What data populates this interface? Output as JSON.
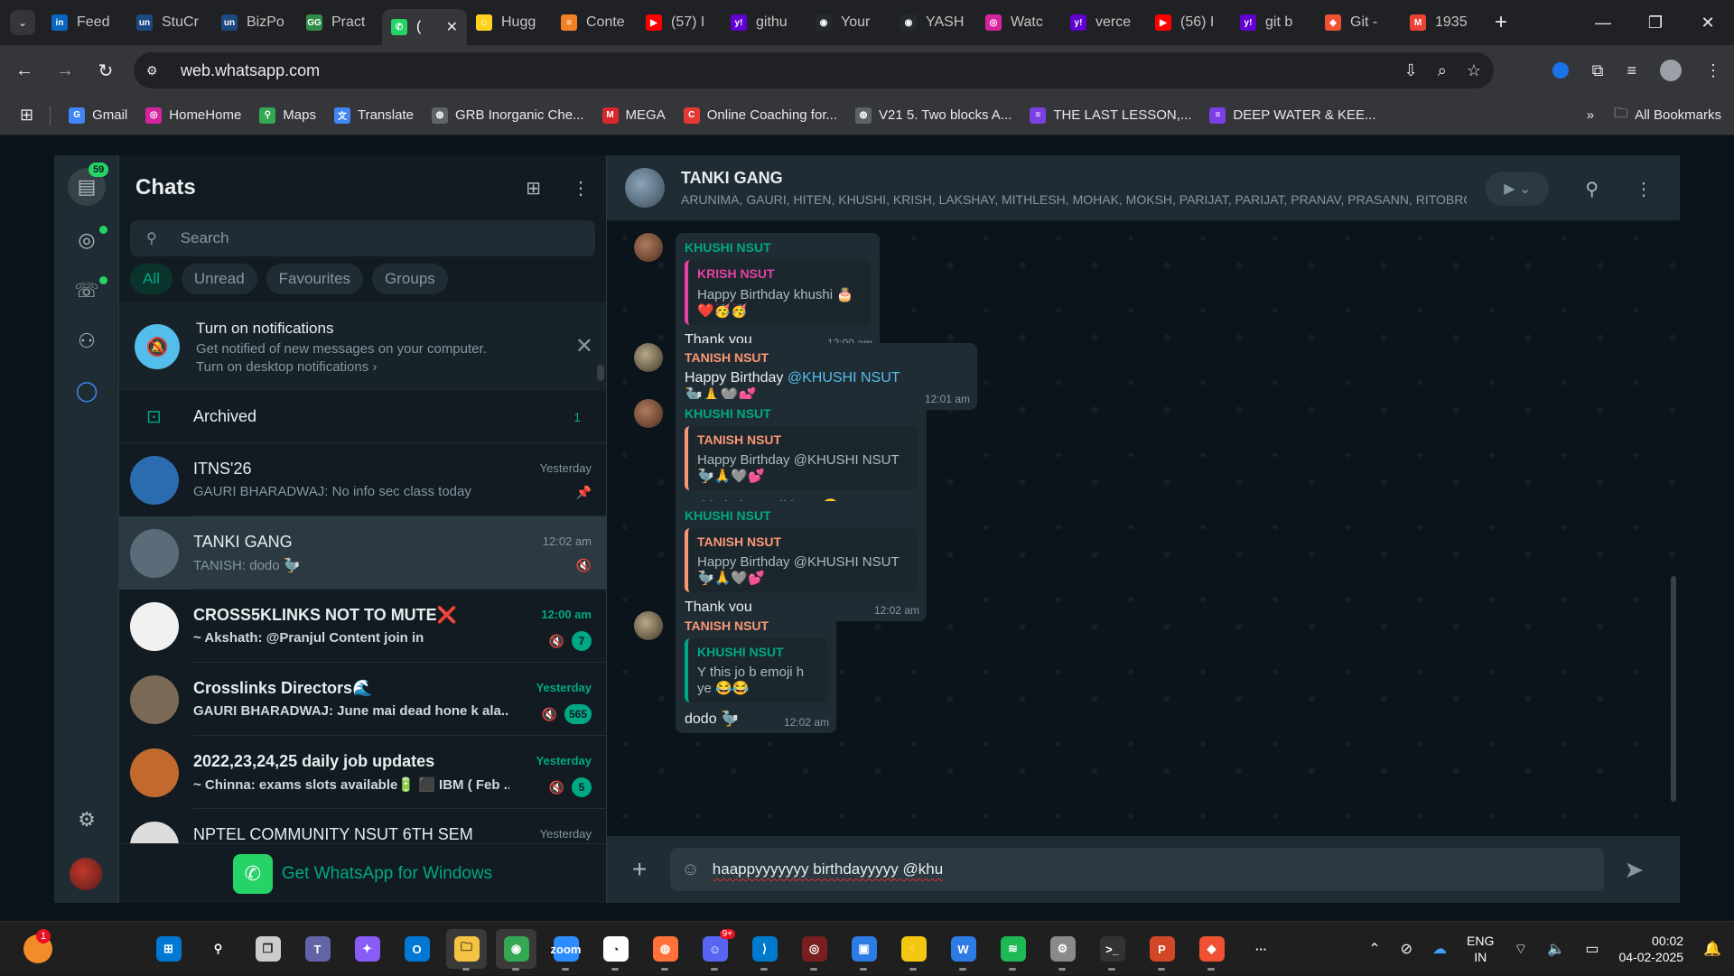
{
  "browser": {
    "tabs": [
      {
        "title": "Feed",
        "icon": "linkedin-icon",
        "color": "#0a66c2",
        "glyph": "in"
      },
      {
        "title": "StuCr",
        "icon": "unstop-icon",
        "color": "#1c4980",
        "glyph": "un"
      },
      {
        "title": "BizPo",
        "icon": "unstop-icon",
        "color": "#1c4980",
        "glyph": "un"
      },
      {
        "title": "Pract",
        "icon": "gfg-icon",
        "color": "#2f8d46",
        "glyph": "GG"
      },
      {
        "title": "(",
        "icon": "whatsapp-icon",
        "color": "#25d366",
        "glyph": "✆",
        "active": true
      },
      {
        "title": "Hugg",
        "icon": "huggingface-icon",
        "color": "#ffd21e",
        "glyph": "☺"
      },
      {
        "title": "Conte",
        "icon": "stackoverflow-icon",
        "color": "#f48024",
        "glyph": "≡"
      },
      {
        "title": "(57) I",
        "icon": "youtube-icon",
        "color": "#ff0000",
        "glyph": "▶"
      },
      {
        "title": "githu",
        "icon": "yahoo-icon",
        "color": "#6001d2",
        "glyph": "y!"
      },
      {
        "title": "Your",
        "icon": "github-icon",
        "color": "#24292f",
        "glyph": "◉"
      },
      {
        "title": "YASH",
        "icon": "github-icon",
        "color": "#24292f",
        "glyph": "◉"
      },
      {
        "title": "Watc",
        "icon": "instagram-icon",
        "color": "#d6249f",
        "glyph": "◎"
      },
      {
        "title": "verce",
        "icon": "yahoo-icon",
        "color": "#6001d2",
        "glyph": "y!"
      },
      {
        "title": "(56) I",
        "icon": "youtube-icon",
        "color": "#ff0000",
        "glyph": "▶"
      },
      {
        "title": "git b",
        "icon": "yahoo-icon",
        "color": "#6001d2",
        "glyph": "y!"
      },
      {
        "title": "Git -",
        "icon": "git-icon",
        "color": "#f05133",
        "glyph": "◆"
      },
      {
        "title": "1935",
        "icon": "gmail-icon",
        "color": "#ea4335",
        "glyph": "M"
      }
    ],
    "url": "web.whatsapp.com",
    "bookmarks": [
      {
        "label": "Gmail",
        "icon": "google-icon",
        "color": "#4285f4",
        "glyph": "G"
      },
      {
        "label": "HomeHome",
        "icon": "instagram-icon",
        "color": "#d6249f",
        "glyph": "◎"
      },
      {
        "label": "Maps",
        "icon": "maps-icon",
        "color": "#34a853",
        "glyph": "⚲"
      },
      {
        "label": "Translate",
        "icon": "translate-icon",
        "color": "#4285f4",
        "glyph": "文"
      },
      {
        "label": "GRB Inorganic Che...",
        "icon": "globe-icon",
        "color": "#5f6368",
        "glyph": "◍"
      },
      {
        "label": "MEGA",
        "icon": "mega-icon",
        "color": "#d9272e",
        "glyph": "M"
      },
      {
        "label": "Online Coaching for...",
        "icon": "coaching-icon",
        "color": "#e53935",
        "glyph": "C"
      },
      {
        "label": "V21 5. Two blocks A...",
        "icon": "globe-icon",
        "color": "#5f6368",
        "glyph": "◍"
      },
      {
        "label": "THE LAST LESSON,...",
        "icon": "doc-icon",
        "color": "#7b3fe4",
        "glyph": "≡"
      },
      {
        "label": "DEEP WATER & KEE...",
        "icon": "doc-icon",
        "color": "#7b3fe4",
        "glyph": "≡"
      }
    ],
    "all_bookmarks": "All Bookmarks"
  },
  "rail": {
    "chats_badge": "59"
  },
  "sidebar": {
    "title": "Chats",
    "search_placeholder": "Search",
    "filters": [
      "All",
      "Unread",
      "Favourites",
      "Groups"
    ],
    "notification": {
      "title": "Turn on notifications",
      "line1": "Get notified of new messages on your computer.",
      "line2": "Turn on desktop notifications"
    },
    "archived": {
      "label": "Archived",
      "count": "1"
    },
    "chats": [
      {
        "name": "ITNS'26",
        "last": "GAURI BHARADWAJ: No info sec class today",
        "time": "Yesterday",
        "pinned": true,
        "avatar": "#2b6cb0"
      },
      {
        "name": "TANKI GANG",
        "last": "TANISH: dodo 🦤",
        "time": "12:02 am",
        "muted": true,
        "selected": true,
        "avatar": "#5b6b78"
      },
      {
        "name": "CROSS5KLINKS NOT TO MUTE❌",
        "last": "~ Akshath: @Pranjul Content join in",
        "time": "12:00 am",
        "muted": true,
        "unread": "7",
        "bold": true,
        "avatar": "#f1f1f1"
      },
      {
        "name": "Crosslinks Directors🌊",
        "last": "GAURI BHARADWAJ: June mai dead hone k ala...",
        "time": "Yesterday",
        "muted": true,
        "unread": "565",
        "bold": true,
        "avatar": "#7a6a55"
      },
      {
        "name": "2022,23,24,25 daily job updates",
        "last": "~ Chinna: exams slots available🔋 ⬛ IBM ( Feb ...",
        "time": "Yesterday",
        "muted": true,
        "unread": "5",
        "bold": true,
        "avatar": "#c26a2e"
      },
      {
        "name": "NPTEL COMMUNITY NSUT 6TH SEM",
        "last": "",
        "time": "Yesterday",
        "avatar": "#ddd"
      }
    ],
    "get_app": "Get WhatsApp for Windows"
  },
  "conversation": {
    "group_name": "TANKI GANG",
    "members": "ARUNIMA, GAURI, HITEN, KHUSHI, KRISH, LAKSHAY, MITHLESH, MOHAK, MOKSH, PARIJAT, PARIJAT, PRANAV, PRASANN, RITOBROTO,...",
    "messages": [
      {
        "sender": "KHUSHI NSUT",
        "quote_name": "KRISH NSUT",
        "quote_text": "Happy Birthday khushi 🎂❤️🥳🥳",
        "text": "Thank you",
        "time": "12:00 am"
      },
      {
        "sender": "TANISH NSUT",
        "text_pre": "Happy Birthday ",
        "mention": "@KHUSHI NSUT",
        "text_post": " 🦤🙏🩶💕",
        "time": "12:01 am"
      },
      {
        "sender": "KHUSHI NSUT",
        "quote_name": "TANISH NSUT",
        "quote_text": "Happy Birthday @KHUSHI NSUT 🦤🙏🩶💕",
        "text": "Y this jo b emoji h ye 😂😂",
        "time": "12:02 am"
      },
      {
        "sender": "KHUSHI NSUT",
        "quote_name": "TANISH NSUT",
        "quote_text": "Happy Birthday @KHUSHI NSUT 🦤🙏🩶💕",
        "text": "Thank you",
        "time": "12:02 am"
      },
      {
        "sender": "TANISH NSUT",
        "quote_name": "KHUSHI NSUT",
        "quote_text": "Y this jo b emoji h ye 😂😂",
        "text": "dodo 🦤",
        "time": "12:02 am"
      }
    ],
    "composer_text": "haappyyyyyyy birthdayyyyy @khu"
  },
  "taskbar": {
    "weather_badge": "1",
    "discord_badge": "9+",
    "lang_line1": "ENG",
    "lang_line2": "IN",
    "time": "00:02",
    "date": "04-02-2025"
  }
}
